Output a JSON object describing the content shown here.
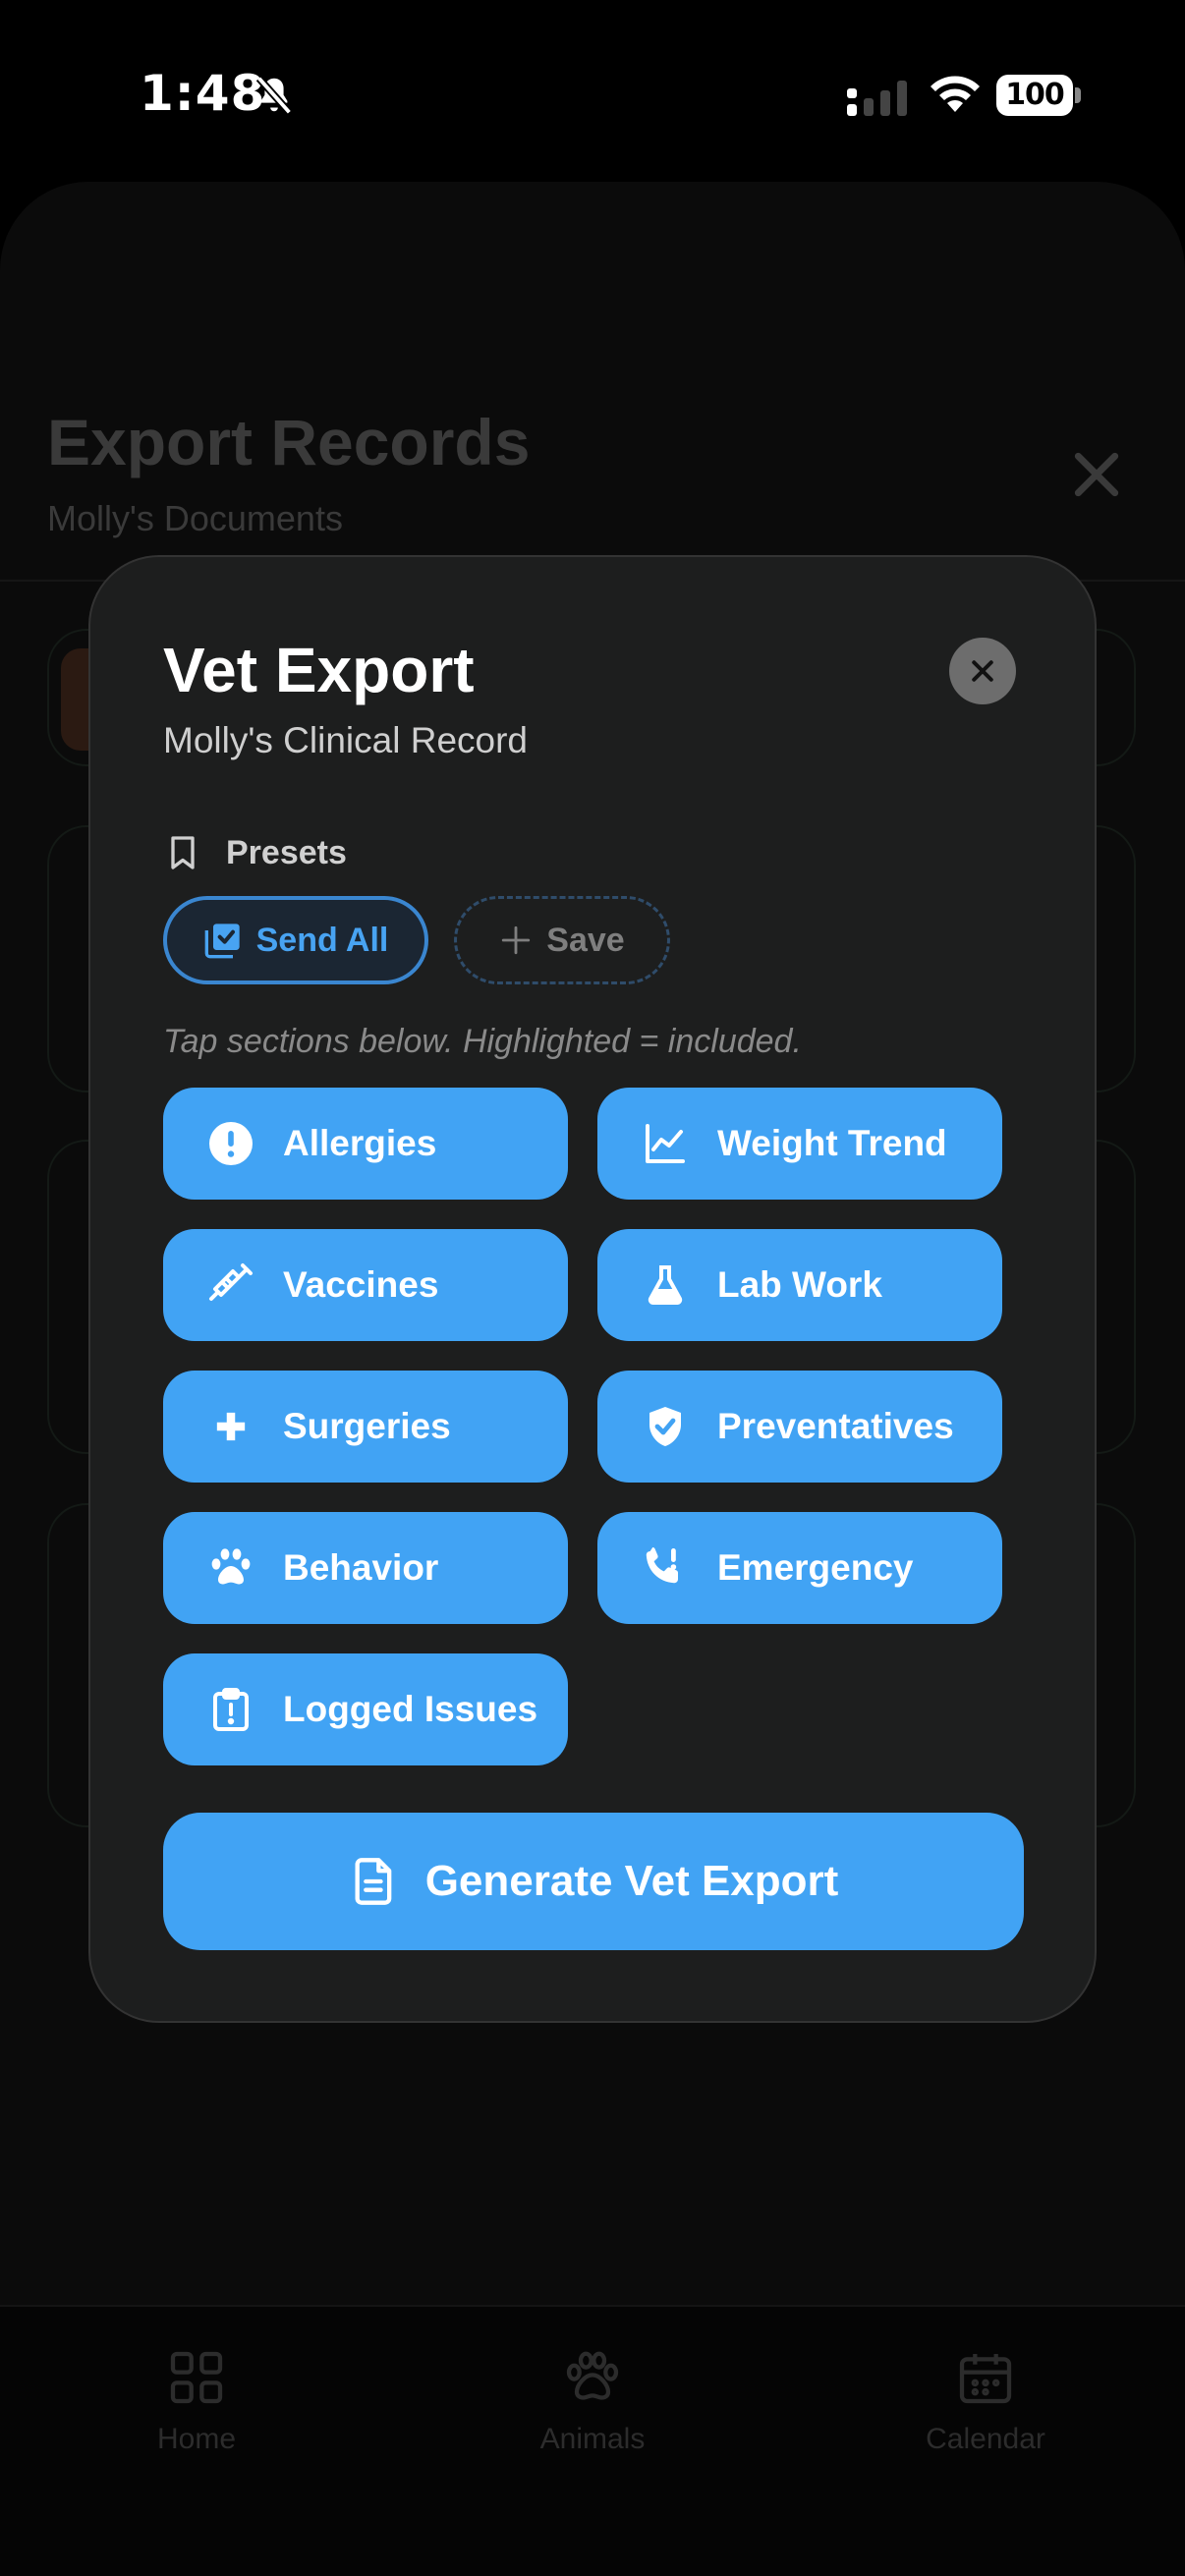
{
  "status_bar": {
    "time": "1:48",
    "battery": "100"
  },
  "background": {
    "title": "Export Records",
    "subtitle": "Molly's Documents"
  },
  "bottom_nav": {
    "items": [
      {
        "label": "Home",
        "icon": "grid-icon"
      },
      {
        "label": "Animals",
        "icon": "paw-icon"
      },
      {
        "label": "Calendar",
        "icon": "calendar-icon"
      }
    ]
  },
  "modal": {
    "title": "Vet Export",
    "subtitle": "Molly's Clinical Record",
    "presets_label": "Presets",
    "presets": [
      {
        "label": "Send All",
        "icon": "checklist-icon",
        "selected": true
      },
      {
        "label": "Save",
        "icon": "plus-icon",
        "selected": false
      }
    ],
    "hint": "Tap sections below. Highlighted = included.",
    "sections": [
      {
        "label": "Allergies",
        "icon": "alert-circle-icon",
        "included": true
      },
      {
        "label": "Weight Trend",
        "icon": "line-chart-icon",
        "included": true
      },
      {
        "label": "Vaccines",
        "icon": "syringe-icon",
        "included": true
      },
      {
        "label": "Lab Work",
        "icon": "flask-icon",
        "included": true
      },
      {
        "label": "Surgeries",
        "icon": "medical-cross-icon",
        "included": true
      },
      {
        "label": "Preventatives",
        "icon": "shield-check-icon",
        "included": true
      },
      {
        "label": "Behavior",
        "icon": "paw-icon",
        "included": true
      },
      {
        "label": "Emergency",
        "icon": "phone-alert-icon",
        "included": true
      },
      {
        "label": "Logged Issues",
        "icon": "clipboard-alert-icon",
        "included": true
      }
    ],
    "generate_label": "Generate Vet Export"
  },
  "colors": {
    "accent": "#41a3f4",
    "modal_bg": "#1d1e1e",
    "page_bg": "#000000"
  }
}
